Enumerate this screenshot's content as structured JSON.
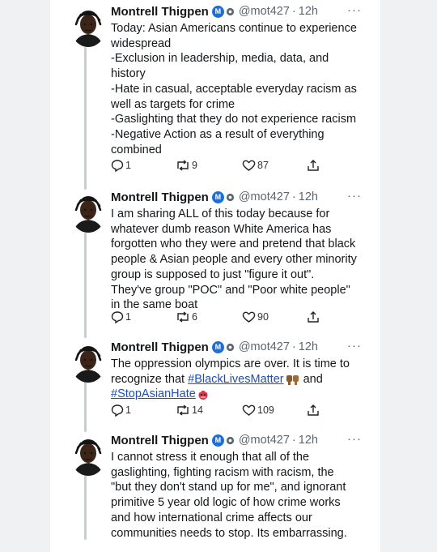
{
  "author": {
    "name": "Montrell Thigpen",
    "badge_letter": "M",
    "handle": "@mot427",
    "separator": "·"
  },
  "more_glyph": "···",
  "tweets": [
    {
      "time": "12h",
      "lines": [
        "Today: Asian Americans continue to experience",
        "widespread",
        "-Exclusion in leadership, media, data, and",
        "history",
        "-Hate in casual, acceptable everyday racism as",
        "well as targets for crime",
        "-Gaslighting that they do not experience racism",
        "-Negative Action as a result of everything",
        "combined"
      ],
      "replies": "1",
      "retweets": "9",
      "likes": "87"
    },
    {
      "time": "12h",
      "lines": [
        "I am sharing ALL of this today because for",
        "whatever dumb reason White America has",
        "forgotten who they were and pretend that black",
        "people & Asian people and every other minority",
        "group is supposed to just \"figure it out\".",
        "They've group \"POC\" and \"Poor white people\"",
        "in the same boat"
      ],
      "replies": "1",
      "retweets": "6",
      "likes": "90"
    },
    {
      "time": "12h",
      "line1": "The oppression olympics are over. It is time to",
      "line2_prefix": "recognize that ",
      "hashtag1": "#BlackLivesMatter",
      "line2_suffix": " and",
      "hashtag2": "#StopAsianHate",
      "replies": "1",
      "retweets": "14",
      "likes": "109"
    },
    {
      "time": "12h",
      "lines": [
        "I cannot stress it enough that all of the",
        "gaslighting, fighting racism with racism, the",
        "\"but they don't stand up for me\", and ignorant",
        "primitive 5 year old logic of how crime works",
        "and how international crime affects our",
        "communities needs to stop. Its embarrassing."
      ]
    }
  ],
  "icons": {
    "reply": "reply-icon",
    "retweet": "retweet-icon",
    "like": "heart-icon",
    "share": "share-icon"
  }
}
